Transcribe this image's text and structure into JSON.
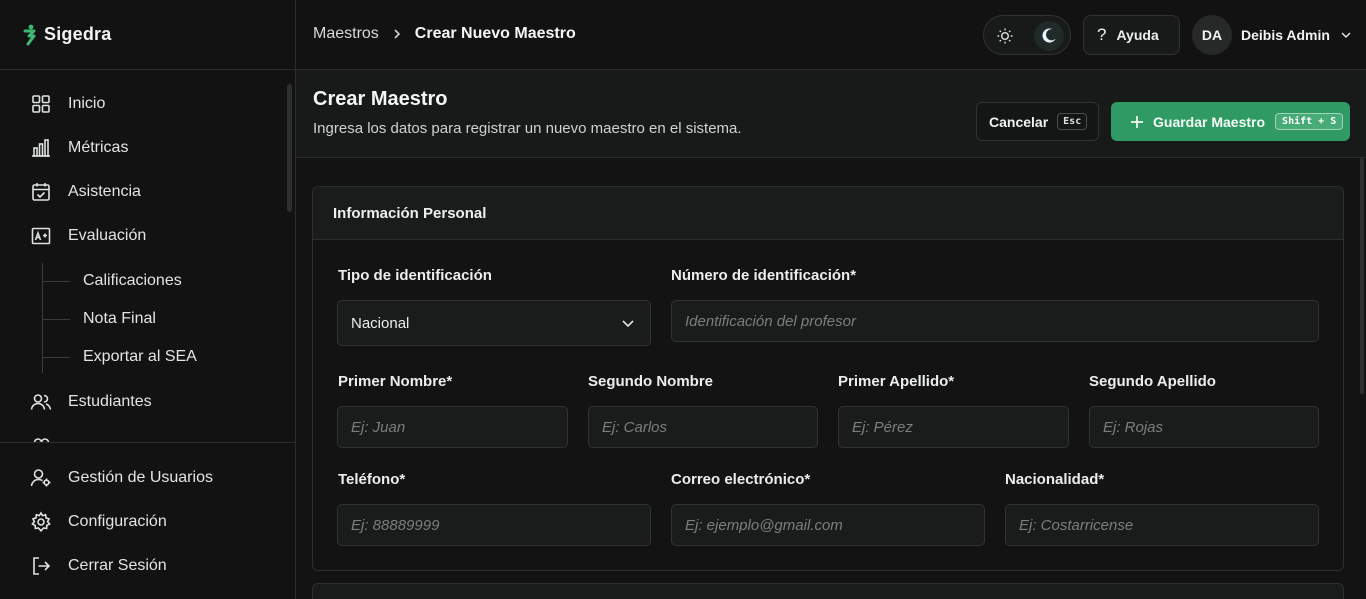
{
  "brand": {
    "name": "Sigedra"
  },
  "sidebar": {
    "items": [
      {
        "label": "Inicio"
      },
      {
        "label": "Métricas"
      },
      {
        "label": "Asistencia"
      },
      {
        "label": "Evaluación"
      },
      {
        "label": "Estudiantes"
      }
    ],
    "subitems": [
      {
        "label": "Calificaciones"
      },
      {
        "label": "Nota Final"
      },
      {
        "label": "Exportar al SEA"
      }
    ],
    "bottom": [
      {
        "label": "Gestión de Usuarios"
      },
      {
        "label": "Configuración"
      },
      {
        "label": "Cerrar Sesión"
      }
    ]
  },
  "header": {
    "breadcrumb": {
      "parent": "Maestros",
      "current": "Crear Nuevo Maestro"
    },
    "help_label": "Ayuda",
    "user": {
      "initials": "DA",
      "name": "Deibis Admin"
    }
  },
  "page": {
    "title": "Crear Maestro",
    "subtitle": "Ingresa los datos para registrar un nuevo maestro en el sistema.",
    "cancel": {
      "label": "Cancelar",
      "shortcut": "Esc"
    },
    "save": {
      "label": "Guardar Maestro",
      "shortcut": "Shift + S"
    }
  },
  "form": {
    "section_title": "Información Personal",
    "id_type": {
      "label": "Tipo de identificación",
      "value": "Nacional"
    },
    "id_number": {
      "label": "Número de identificación*",
      "placeholder": "Identificación del profesor"
    },
    "first_name": {
      "label": "Primer Nombre*",
      "placeholder": "Ej: Juan"
    },
    "second_name": {
      "label": "Segundo Nombre",
      "placeholder": "Ej: Carlos"
    },
    "first_last": {
      "label": "Primer Apellido*",
      "placeholder": "Ej: Pérez"
    },
    "second_last": {
      "label": "Segundo Apellido",
      "placeholder": "Ej: Rojas"
    },
    "phone": {
      "label": "Teléfono*",
      "placeholder": "Ej: 88889999"
    },
    "email": {
      "label": "Correo electrónico*",
      "placeholder": "Ej: ejemplo@gmail.com"
    },
    "nationality": {
      "label": "Nacionalidad*",
      "placeholder": "Ej: Costarricense"
    }
  },
  "colors": {
    "accent": "#2f9a63",
    "background": "#111211",
    "surface": "#1a1c1b"
  }
}
